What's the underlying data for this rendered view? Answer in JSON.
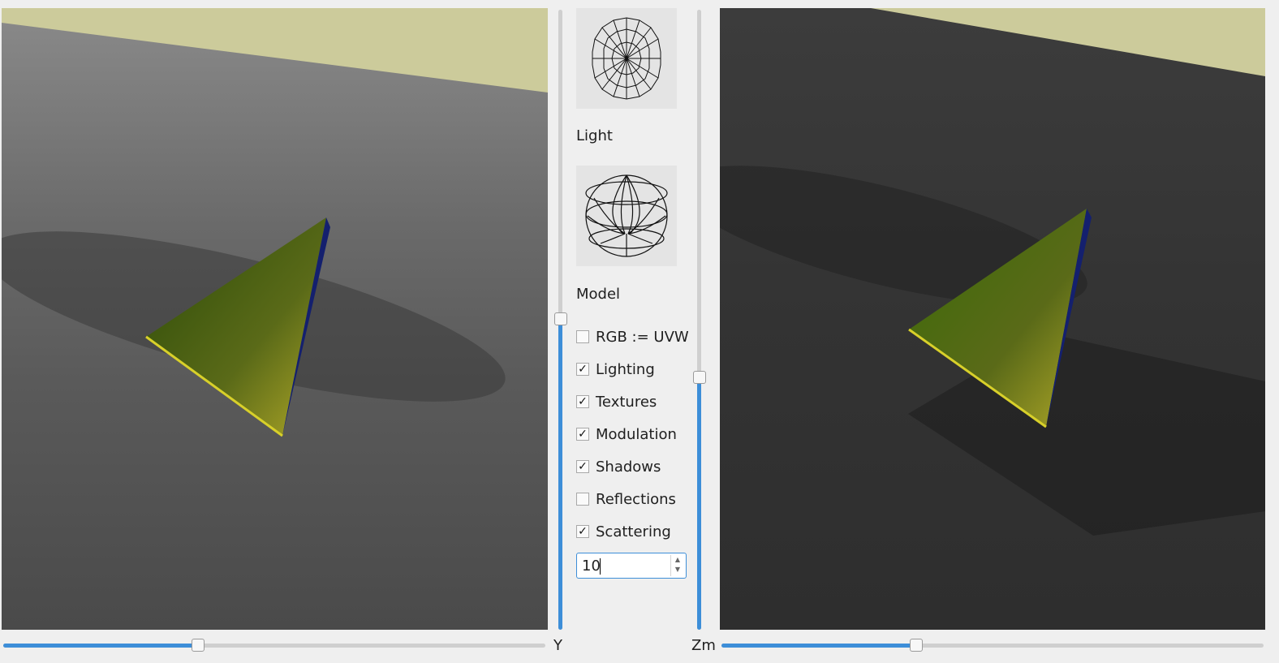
{
  "controls": {
    "light_label": "Light",
    "model_label": "Model",
    "checkboxes": [
      {
        "label": "RGB := UVW",
        "checked": false
      },
      {
        "label": "Lighting",
        "checked": true
      },
      {
        "label": "Textures",
        "checked": true
      },
      {
        "label": "Modulation",
        "checked": true
      },
      {
        "label": "Shadows",
        "checked": true
      },
      {
        "label": "Reflections",
        "checked": false
      },
      {
        "label": "Scattering",
        "checked": true
      }
    ],
    "scatter_value": "10"
  },
  "sliders": {
    "y_label": "Y",
    "zm_label": "Zm",
    "left_vertical_value": 0.49,
    "right_vertical_value": 0.41,
    "y_value": 0.36,
    "zm_value": 0.36
  },
  "colors": {
    "accent": "#3d8ed8",
    "sky": "#cccb9b",
    "ground": "#6e6e6e",
    "pyramid_face": "#3a5a10",
    "pyramid_edge": "#d8d02a",
    "pyramid_side": "#14206e"
  }
}
